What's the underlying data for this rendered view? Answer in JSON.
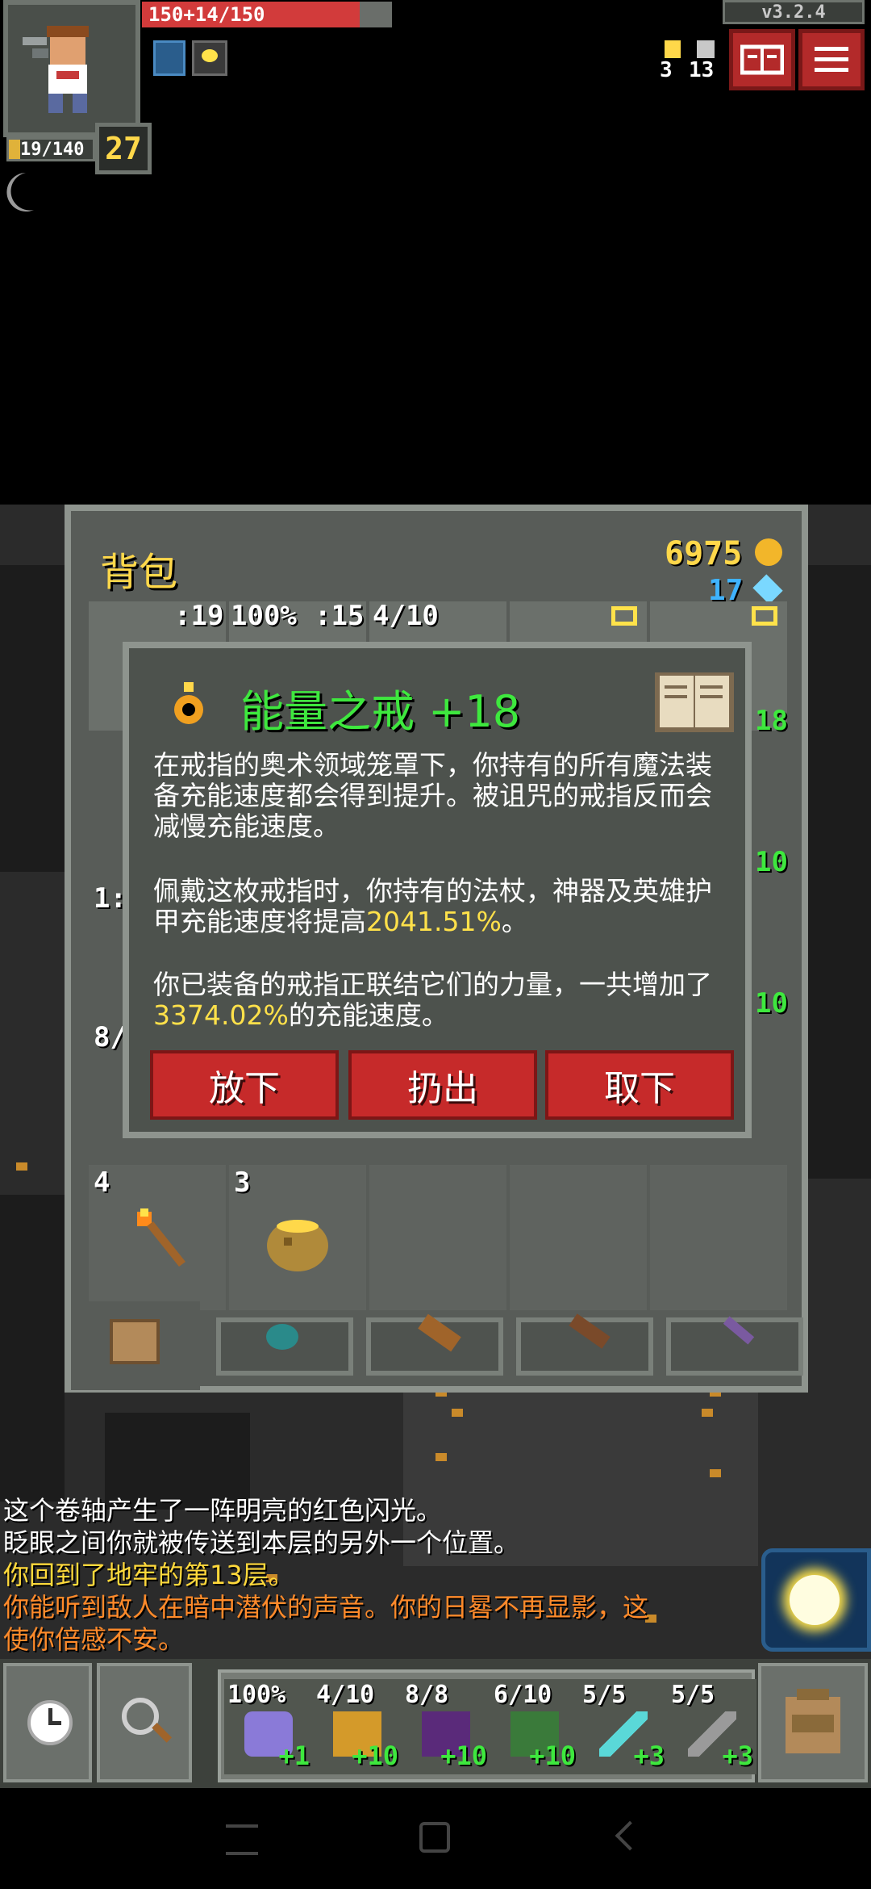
{
  "hud": {
    "hp_text": "150+14/150",
    "exp_text": "19/140",
    "level": "27",
    "version": "v3.2.4",
    "depth_count": "3",
    "key_count": "13"
  },
  "inventory": {
    "title": "背包",
    "gold": "6975",
    "gems": "17",
    "slot_labels": [
      ":19",
      "100%",
      ":15",
      "4/10"
    ],
    "right_col_levels": [
      "18",
      "10",
      "10"
    ],
    "left_partial_labels": [
      "1:",
      "8/"
    ],
    "row_counts": [
      "4",
      "3"
    ]
  },
  "dialog": {
    "item_name": "能量之戒 +18",
    "para1": "在戒指的奥术领域笼罩下，你持有的所有魔法装备充能速度都会得到提升。被诅咒的戒指反而会减慢充能速度。",
    "para2_prefix": "佩戴这枚戒指时，你持有的法杖，神器及英雄护甲充能速度将提高",
    "para2_value": "2041.51%",
    "para2_suffix": "。",
    "para3_prefix": "你已装备的戒指正联结它们的力量，一共增加了",
    "para3_value": "3374.02%",
    "para3_suffix": "的充能速度。",
    "buttons": [
      "放下",
      "扔出",
      "取下"
    ]
  },
  "log": [
    {
      "text": "这个卷轴产生了一阵明亮的红色闪光。",
      "color": "#ffffff"
    },
    {
      "text": "眨眼之间你就被传送到本层的另外一个位置。",
      "color": "#ffffff"
    },
    {
      "text": "你回到了地牢的第13层。",
      "color": "#ffd93b"
    },
    {
      "text": "你能听到敌人在暗中潜伏的声音。你的日晷不再显影，这",
      "color": "#ff8a2a"
    },
    {
      "text": "使你倍感不安。",
      "color": "#ff8a2a"
    }
  ],
  "quickslots": [
    {
      "top": "100%",
      "bottom": "+1"
    },
    {
      "top": "4/10",
      "bottom": "+10"
    },
    {
      "top": "8/8",
      "bottom": "+10"
    },
    {
      "top": "6/10",
      "bottom": "+10"
    },
    {
      "top": "5/5",
      "bottom": "+3"
    },
    {
      "top": "5/5",
      "bottom": "+3"
    }
  ],
  "colors": {
    "accent_green": "#3ee83e",
    "highlight_yellow": "#ffe14a",
    "button_red": "#c62a2a"
  },
  "icons": [
    "wait-clock-icon",
    "search-magnifier-icon",
    "backpack-icon",
    "journal-icon",
    "menu-icon",
    "light-orb-icon",
    "ring-icon",
    "spellbook-icon"
  ]
}
